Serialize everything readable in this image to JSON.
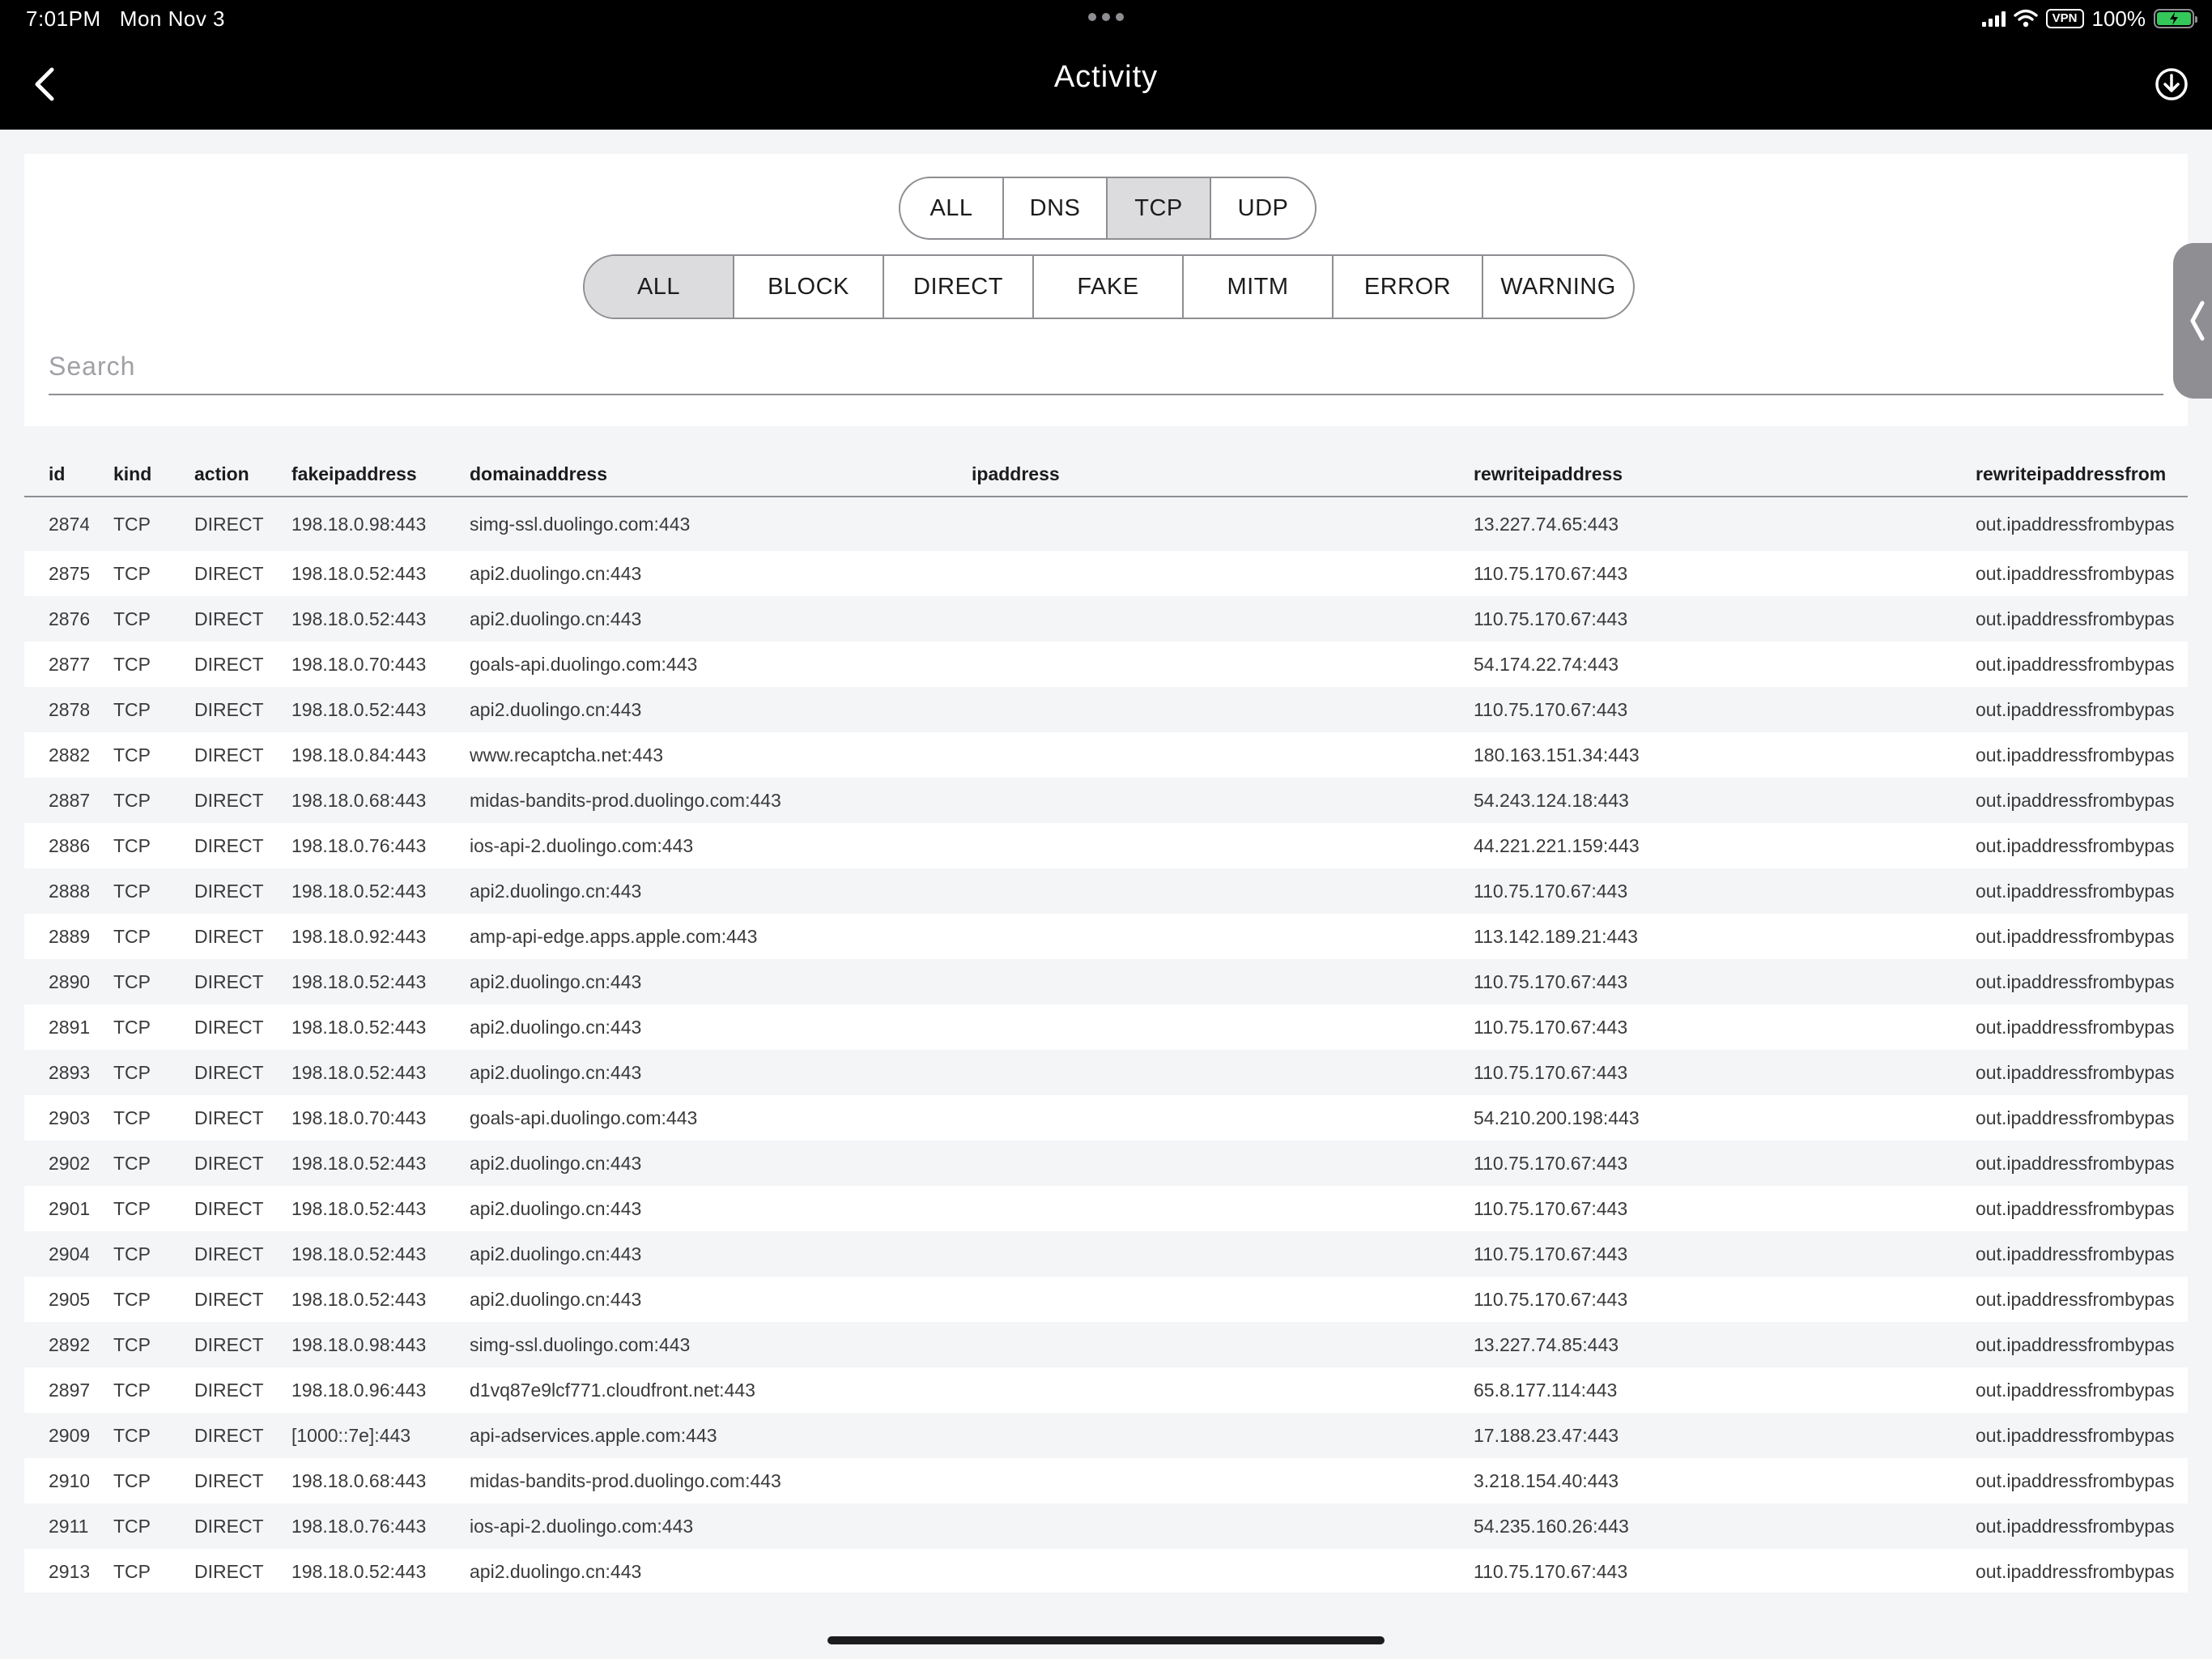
{
  "status_bar": {
    "time": "7:01PM",
    "date": "Mon Nov 3",
    "vpn_label": "VPN",
    "battery": "100%"
  },
  "nav": {
    "title": "Activity",
    "back_icon": "chevron-left-icon",
    "download_icon": "download-circle-icon"
  },
  "filters": {
    "protocol": [
      {
        "label": "ALL",
        "active": false
      },
      {
        "label": "DNS",
        "active": false
      },
      {
        "label": "TCP",
        "active": true
      },
      {
        "label": "UDP",
        "active": false
      }
    ],
    "action": [
      {
        "label": "ALL",
        "active": true
      },
      {
        "label": "BLOCK",
        "active": false
      },
      {
        "label": "DIRECT",
        "active": false
      },
      {
        "label": "FAKE",
        "active": false
      },
      {
        "label": "MITM",
        "active": false
      },
      {
        "label": "ERROR",
        "active": false
      },
      {
        "label": "WARNING",
        "active": false
      }
    ],
    "search_placeholder": "Search"
  },
  "table": {
    "columns": [
      "id",
      "kind",
      "action",
      "fakeipaddress",
      "domainaddress",
      "ipaddress",
      "rewriteipaddress",
      "rewriteipaddressfrom"
    ],
    "rows": [
      [
        "2874",
        "TCP",
        "DIRECT",
        "198.18.0.98:443",
        "simg-ssl.duolingo.com:443",
        "",
        "13.227.74.65:443",
        "out.ipaddressfrombypas"
      ],
      [
        "2875",
        "TCP",
        "DIRECT",
        "198.18.0.52:443",
        "api2.duolingo.cn:443",
        "",
        "110.75.170.67:443",
        "out.ipaddressfrombypas"
      ],
      [
        "2876",
        "TCP",
        "DIRECT",
        "198.18.0.52:443",
        "api2.duolingo.cn:443",
        "",
        "110.75.170.67:443",
        "out.ipaddressfrombypas"
      ],
      [
        "2877",
        "TCP",
        "DIRECT",
        "198.18.0.70:443",
        "goals-api.duolingo.com:443",
        "",
        "54.174.22.74:443",
        "out.ipaddressfrombypas"
      ],
      [
        "2878",
        "TCP",
        "DIRECT",
        "198.18.0.52:443",
        "api2.duolingo.cn:443",
        "",
        "110.75.170.67:443",
        "out.ipaddressfrombypas"
      ],
      [
        "2882",
        "TCP",
        "DIRECT",
        "198.18.0.84:443",
        "www.recaptcha.net:443",
        "",
        "180.163.151.34:443",
        "out.ipaddressfrombypas"
      ],
      [
        "2887",
        "TCP",
        "DIRECT",
        "198.18.0.68:443",
        "midas-bandits-prod.duolingo.com:443",
        "",
        "54.243.124.18:443",
        "out.ipaddressfrombypas"
      ],
      [
        "2886",
        "TCP",
        "DIRECT",
        "198.18.0.76:443",
        "ios-api-2.duolingo.com:443",
        "",
        "44.221.221.159:443",
        "out.ipaddressfrombypas"
      ],
      [
        "2888",
        "TCP",
        "DIRECT",
        "198.18.0.52:443",
        "api2.duolingo.cn:443",
        "",
        "110.75.170.67:443",
        "out.ipaddressfrombypas"
      ],
      [
        "2889",
        "TCP",
        "DIRECT",
        "198.18.0.92:443",
        "amp-api-edge.apps.apple.com:443",
        "",
        "113.142.189.21:443",
        "out.ipaddressfrombypas"
      ],
      [
        "2890",
        "TCP",
        "DIRECT",
        "198.18.0.52:443",
        "api2.duolingo.cn:443",
        "",
        "110.75.170.67:443",
        "out.ipaddressfrombypas"
      ],
      [
        "2891",
        "TCP",
        "DIRECT",
        "198.18.0.52:443",
        "api2.duolingo.cn:443",
        "",
        "110.75.170.67:443",
        "out.ipaddressfrombypas"
      ],
      [
        "2893",
        "TCP",
        "DIRECT",
        "198.18.0.52:443",
        "api2.duolingo.cn:443",
        "",
        "110.75.170.67:443",
        "out.ipaddressfrombypas"
      ],
      [
        "2903",
        "TCP",
        "DIRECT",
        "198.18.0.70:443",
        "goals-api.duolingo.com:443",
        "",
        "54.210.200.198:443",
        "out.ipaddressfrombypas"
      ],
      [
        "2902",
        "TCP",
        "DIRECT",
        "198.18.0.52:443",
        "api2.duolingo.cn:443",
        "",
        "110.75.170.67:443",
        "out.ipaddressfrombypas"
      ],
      [
        "2901",
        "TCP",
        "DIRECT",
        "198.18.0.52:443",
        "api2.duolingo.cn:443",
        "",
        "110.75.170.67:443",
        "out.ipaddressfrombypas"
      ],
      [
        "2904",
        "TCP",
        "DIRECT",
        "198.18.0.52:443",
        "api2.duolingo.cn:443",
        "",
        "110.75.170.67:443",
        "out.ipaddressfrombypas"
      ],
      [
        "2905",
        "TCP",
        "DIRECT",
        "198.18.0.52:443",
        "api2.duolingo.cn:443",
        "",
        "110.75.170.67:443",
        "out.ipaddressfrombypas"
      ],
      [
        "2892",
        "TCP",
        "DIRECT",
        "198.18.0.98:443",
        "simg-ssl.duolingo.com:443",
        "",
        "13.227.74.85:443",
        "out.ipaddressfrombypas"
      ],
      [
        "2897",
        "TCP",
        "DIRECT",
        "198.18.0.96:443",
        "d1vq87e9lcf771.cloudfront.net:443",
        "",
        "65.8.177.114:443",
        "out.ipaddressfrombypas"
      ],
      [
        "2909",
        "TCP",
        "DIRECT",
        "[1000::7e]:443",
        "api-adservices.apple.com:443",
        "",
        "17.188.23.47:443",
        "out.ipaddressfrombypas"
      ],
      [
        "2910",
        "TCP",
        "DIRECT",
        "198.18.0.68:443",
        "midas-bandits-prod.duolingo.com:443",
        "",
        "3.218.154.40:443",
        "out.ipaddressfrombypas"
      ],
      [
        "2911",
        "TCP",
        "DIRECT",
        "198.18.0.76:443",
        "ios-api-2.duolingo.com:443",
        "",
        "54.235.160.26:443",
        "out.ipaddressfrombypas"
      ],
      [
        "2913",
        "TCP",
        "DIRECT",
        "198.18.0.52:443",
        "api2.duolingo.cn:443",
        "",
        "110.75.170.67:443",
        "out.ipaddressfrombypas"
      ]
    ]
  }
}
